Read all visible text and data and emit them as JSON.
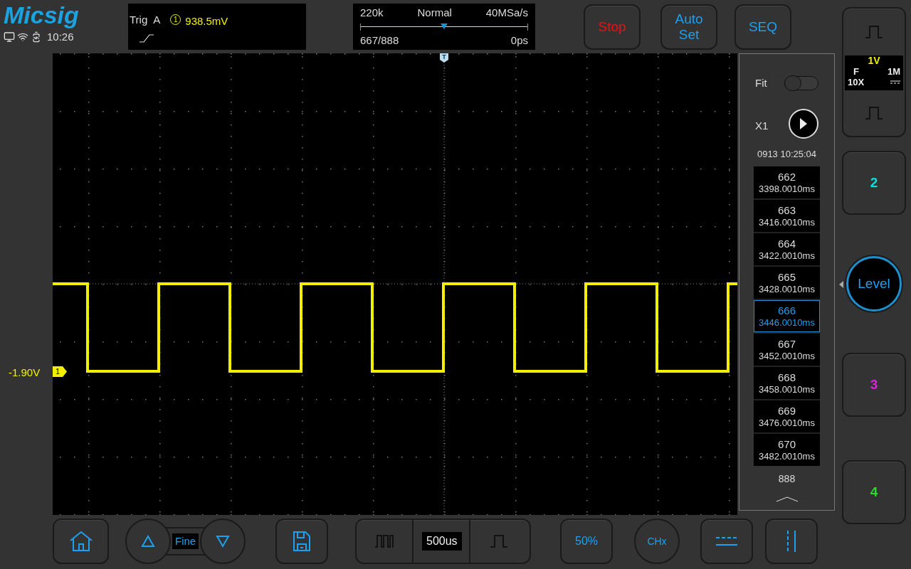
{
  "brand": {
    "logo": "Micsig",
    "time": "10:26"
  },
  "trigger": {
    "label": "Trig",
    "source": "A",
    "channel": "1",
    "value": "938.5mV"
  },
  "acquisition": {
    "memory": "220k",
    "mode": "Normal",
    "sample_rate": "40MSa/s",
    "frame": "667/888",
    "delay": "0ps",
    "level": 0.5
  },
  "actions": [
    {
      "label": "Stop",
      "kind": "stop"
    },
    {
      "label": "Auto Set",
      "kind": "normal"
    },
    {
      "label": "SEQ",
      "kind": "normal"
    }
  ],
  "channel_1": {
    "scale": "1V",
    "coupling": "F",
    "impedance": "1M",
    "probe": "10X"
  },
  "channels": [
    {
      "label": "2",
      "color": "#00e0e0"
    },
    {
      "label": "3",
      "color": "#e020e0"
    },
    {
      "label": "4",
      "color": "#20e020"
    }
  ],
  "level_button": "Level",
  "scope": {
    "offset": "-1.90V",
    "marker": "1",
    "trigger_marker": "T"
  },
  "segments": {
    "fit_label": "Fit",
    "fit_on": false,
    "speed": "X1",
    "timestamp": "0913 10:25:04",
    "total": "888",
    "frames": [
      {
        "index": "662",
        "time": "3398.0010ms",
        "selected": false
      },
      {
        "index": "663",
        "time": "3416.0010ms",
        "selected": false
      },
      {
        "index": "664",
        "time": "3422.0010ms",
        "selected": false
      },
      {
        "index": "665",
        "time": "3428.0010ms",
        "selected": false
      },
      {
        "index": "666",
        "time": "3446.0010ms",
        "selected": true
      },
      {
        "index": "667",
        "time": "3452.0010ms",
        "selected": false
      },
      {
        "index": "668",
        "time": "3458.0010ms",
        "selected": false
      },
      {
        "index": "669",
        "time": "3476.0010ms",
        "selected": false
      },
      {
        "index": "670",
        "time": "3482.0010ms",
        "selected": false
      }
    ]
  },
  "toolbar": {
    "fine": "Fine",
    "timebase": "500us",
    "fifty": "50%",
    "chx": "CHx"
  }
}
